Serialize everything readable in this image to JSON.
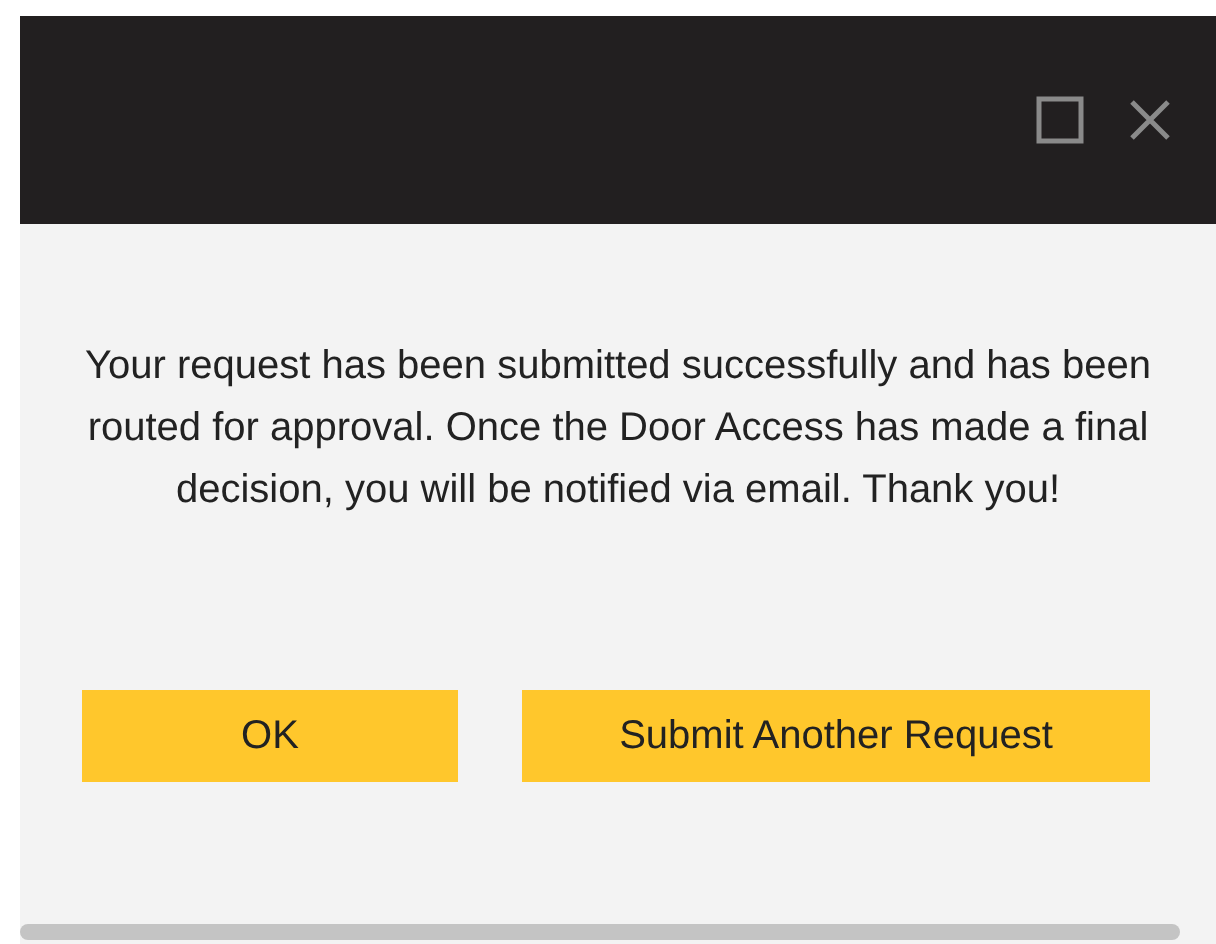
{
  "message": "Your request has been submitted successfully and has been routed for approval. Once the Door Access has made a final decision, you will be notified via email. Thank you!",
  "buttons": [
    {
      "label": "OK",
      "kind": "ok"
    },
    {
      "label": "Submit Another Request",
      "kind": "submit"
    }
  ]
}
